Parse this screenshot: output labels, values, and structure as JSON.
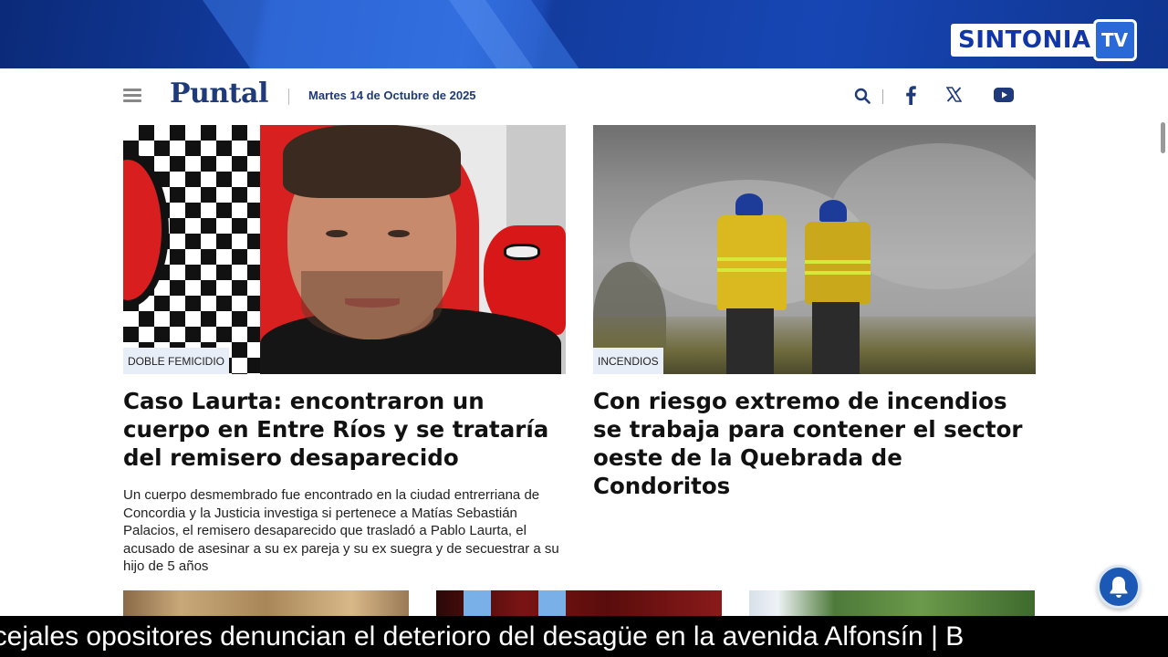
{
  "banner": {
    "logo_word": "SINTONIA",
    "logo_badge": "TV"
  },
  "header": {
    "brand": "Puntal",
    "date": "Martes 14 de Octubre de 2025",
    "icons": [
      "menu-icon",
      "search-icon",
      "facebook-icon",
      "x-icon",
      "youtube-icon"
    ]
  },
  "articles": [
    {
      "tag": "DOBLE FEMICIDIO",
      "headline": "Caso Laurta: encontraron un cuerpo en Entre Ríos y se trataría del remisero desaparecido",
      "summary": "Un cuerpo desmembrado fue encontrado en la ciudad entrerriana de Concordia y la Justicia investiga si pertenece a Matías Sebastián Palacios, el remisero desaparecido que trasladó a Pablo Laurta, el acusado de asesinar a su ex pareja y su ex suegra y de secuestrar a su hijo de 5 años"
    },
    {
      "tag": "INCENDIOS",
      "headline": "Con riesgo extremo de incendios se trabaja para contener el sector oeste de la Quebrada de Condoritos",
      "summary": ""
    }
  ],
  "ticker": {
    "text": "ncejales opositores denuncian el deterioro del desagüe en la avenida Alfonsín | B"
  },
  "colors": {
    "brand": "#1e3a7a",
    "banner": "#1746b4",
    "bell": "#1c58b5"
  }
}
